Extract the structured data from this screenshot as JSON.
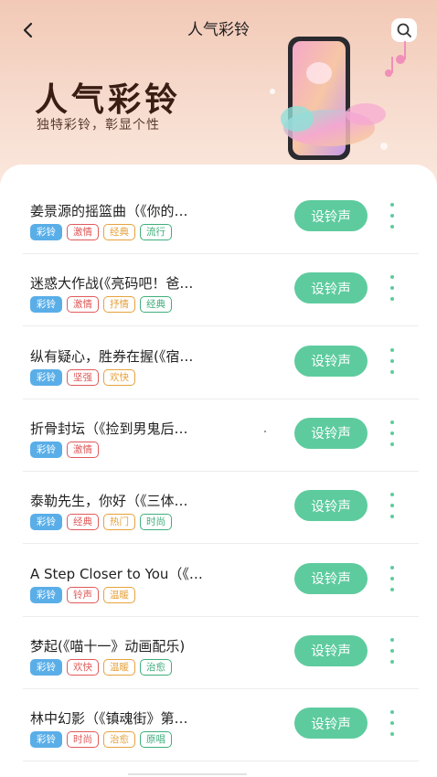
{
  "header": {
    "title": "人气彩铃"
  },
  "banner": {
    "title": "人气彩铃",
    "subtitle": "独特彩铃，彰显个性"
  },
  "icons": {
    "back": "chevron-left-icon",
    "search": "search-icon",
    "more": "more-vertical-icon"
  },
  "colors": {
    "accent": "#5ecb9e",
    "tag_primary": "#5aaee8",
    "tag_red": "#e05a5a",
    "tag_orange": "#e6a23c",
    "tag_green": "#3fae7c",
    "hero_bg": "#f2c9b6"
  },
  "list": {
    "button_label": "设铃声",
    "items": [
      {
        "title": "姜景源的摇篮曲（《你的…",
        "tags": [
          {
            "text": "彩铃",
            "style": "primary"
          },
          {
            "text": "激情",
            "style": "red"
          },
          {
            "text": "经典",
            "style": "orange"
          },
          {
            "text": "流行",
            "style": "green"
          }
        ]
      },
      {
        "title": "迷惑大作战(《亮码吧！爸…",
        "tags": [
          {
            "text": "彩铃",
            "style": "primary"
          },
          {
            "text": "激情",
            "style": "red"
          },
          {
            "text": "抒情",
            "style": "orange"
          },
          {
            "text": "经典",
            "style": "green"
          }
        ]
      },
      {
        "title": "纵有疑心，胜券在握(《宿…",
        "tags": [
          {
            "text": "彩铃",
            "style": "primary"
          },
          {
            "text": "坚强",
            "style": "red"
          },
          {
            "text": "欢快",
            "style": "orange"
          }
        ]
      },
      {
        "title": "折骨封坛（《捡到男鬼后…",
        "tags": [
          {
            "text": "彩铃",
            "style": "primary"
          },
          {
            "text": "激情",
            "style": "red"
          }
        ]
      },
      {
        "title": "泰勒先生，你好（《三体…",
        "tags": [
          {
            "text": "彩铃",
            "style": "primary"
          },
          {
            "text": "经典",
            "style": "red"
          },
          {
            "text": "热门",
            "style": "orange"
          },
          {
            "text": "时尚",
            "style": "green"
          }
        ]
      },
      {
        "title": "A Step Closer to You（《…",
        "tags": [
          {
            "text": "彩铃",
            "style": "primary"
          },
          {
            "text": "铃声",
            "style": "red"
          },
          {
            "text": "温暖",
            "style": "orange"
          }
        ]
      },
      {
        "title": "梦起(《喵十一》动画配乐)",
        "tags": [
          {
            "text": "彩铃",
            "style": "primary"
          },
          {
            "text": "欢快",
            "style": "red"
          },
          {
            "text": "温暖",
            "style": "orange"
          },
          {
            "text": "治愈",
            "style": "green"
          }
        ]
      },
      {
        "title": "林中幻影（《镇魂街》第…",
        "tags": [
          {
            "text": "彩铃",
            "style": "primary"
          },
          {
            "text": "时尚",
            "style": "red"
          },
          {
            "text": "治愈",
            "style": "orange"
          },
          {
            "text": "原唱",
            "style": "green"
          }
        ]
      }
    ]
  }
}
